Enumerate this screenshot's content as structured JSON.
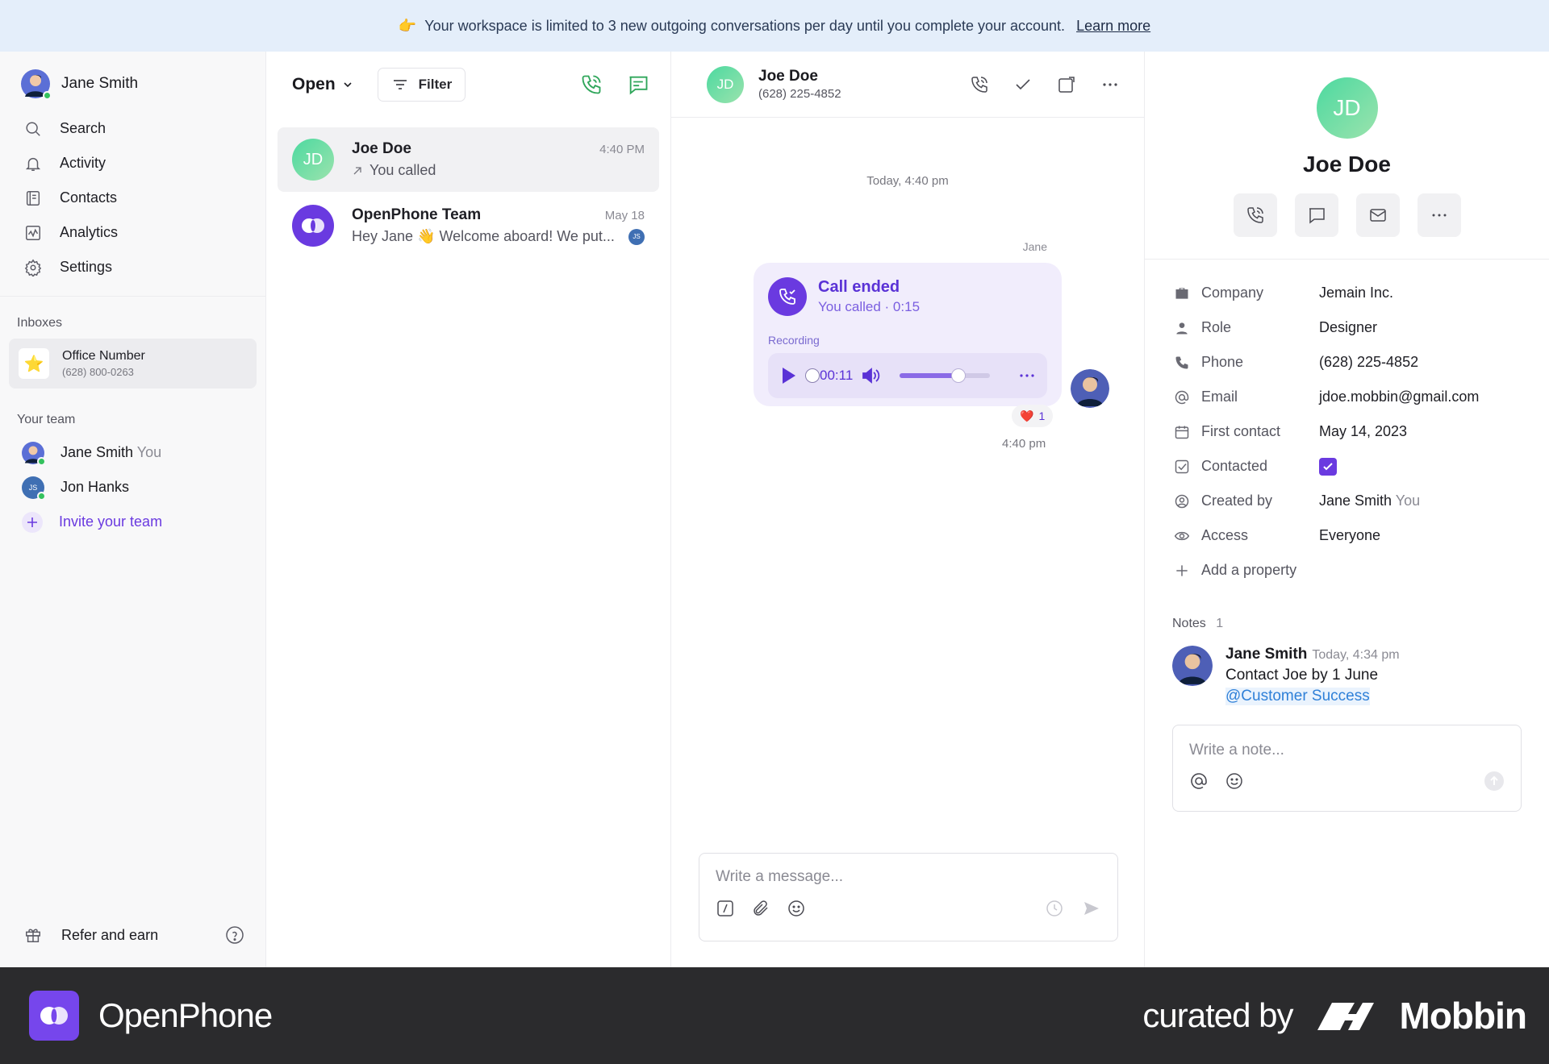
{
  "banner": {
    "emoji": "👉",
    "text": "Your workspace is limited to 3 new outgoing conversations per day until you complete your account.",
    "link": "Learn more"
  },
  "sidebar": {
    "user": "Jane Smith",
    "nav": [
      {
        "label": "Search",
        "icon": "search-icon"
      },
      {
        "label": "Activity",
        "icon": "bell-icon"
      },
      {
        "label": "Contacts",
        "icon": "contacts-icon"
      },
      {
        "label": "Analytics",
        "icon": "analytics-icon"
      },
      {
        "label": "Settings",
        "icon": "gear-icon"
      }
    ],
    "inboxes_title": "Inboxes",
    "inbox": {
      "name": "Office Number",
      "number": "(628) 800-0263",
      "emoji": "⭐"
    },
    "team_title": "Your team",
    "team": [
      {
        "name": "Jane Smith",
        "suffix": "You"
      },
      {
        "name": "Jon Hanks",
        "suffix": "",
        "initials": "JS"
      }
    ],
    "invite": "Invite your team",
    "refer": "Refer and earn"
  },
  "list": {
    "filter_status": "Open",
    "filter_label": "Filter",
    "conversations": [
      {
        "name": "Joe Doe",
        "initials": "JD",
        "time": "4:40 PM",
        "preview": "You called"
      },
      {
        "name": "OpenPhone Team",
        "time": "May 18",
        "preview": "Hey Jane 👋 Welcome aboard! We put...",
        "badge": "JS"
      }
    ]
  },
  "chat": {
    "contact": {
      "name": "Joe Doe",
      "initials": "JD",
      "phone": "(628) 225-4852"
    },
    "day_stamp": "Today, 4:40 pm",
    "sender": "Jane",
    "call": {
      "title": "Call ended",
      "subtitle": "You called · 0:15",
      "recording_label": "Recording",
      "playback_time": "00:11",
      "volume_level": 0.65
    },
    "reaction": {
      "emoji": "❤️",
      "count": "1"
    },
    "message_time": "4:40 pm",
    "composer_placeholder": "Write a message..."
  },
  "details": {
    "initials": "JD",
    "name": "Joe Doe",
    "properties": [
      {
        "key": "Company",
        "value": "Jemain Inc.",
        "icon": "briefcase-icon"
      },
      {
        "key": "Role",
        "value": "Designer",
        "icon": "person-icon"
      },
      {
        "key": "Phone",
        "value": "(628) 225-4852",
        "icon": "phone-icon"
      },
      {
        "key": "Email",
        "value": "jdoe.mobbin@gmail.com",
        "icon": "at-icon"
      },
      {
        "key": "First contact",
        "value": "May 14, 2023",
        "icon": "calendar-icon"
      },
      {
        "key": "Contacted",
        "value": "",
        "icon": "checkbox-icon",
        "checked": true
      },
      {
        "key": "Created by",
        "value": "Jane Smith",
        "suffix": "You",
        "icon": "user-circle-icon"
      },
      {
        "key": "Access",
        "value": "Everyone",
        "icon": "eye-icon"
      }
    ],
    "add_property": "Add a property",
    "notes_title": "Notes",
    "notes_count": "1",
    "note": {
      "author": "Jane Smith",
      "time": "Today, 4:34 pm",
      "text": "Contact Joe by 1 June",
      "mention": "@Customer Success"
    },
    "note_placeholder": "Write a note..."
  },
  "footer": {
    "brand": "OpenPhone",
    "curated": "curated by",
    "mobbin": "Mobbin"
  },
  "colors": {
    "accent": "#6a3ae0",
    "green": "#34c25e",
    "banner_bg": "#e4eefa",
    "footer_bg": "#2b2b2d"
  }
}
